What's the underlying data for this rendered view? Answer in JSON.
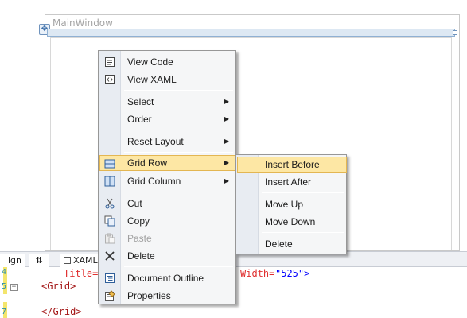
{
  "window": {
    "title": "MainWindow"
  },
  "editor": {
    "tabs": [
      {
        "label": "ign"
      },
      {
        "label": "⇅"
      },
      {
        "label": "XAML"
      }
    ],
    "lines": [
      {
        "num": "4",
        "attr": "Title=",
        "tail_attr": "Width=",
        "tail_val": "\"525\">"
      },
      {
        "num": "5",
        "open_tag": "<Grid>"
      },
      {
        "num": "7",
        "close_tag": "</Grid>"
      }
    ]
  },
  "context_menu": {
    "items": [
      {
        "label": "View Code",
        "icon": "view-code-icon"
      },
      {
        "label": "View XAML",
        "icon": "view-xaml-icon"
      },
      {
        "label": "Select",
        "has_submenu": true
      },
      {
        "label": "Order",
        "has_submenu": true
      },
      {
        "label": "Reset Layout",
        "has_submenu": true
      },
      {
        "label": "Grid Row",
        "icon": "grid-row-icon",
        "has_submenu": true,
        "highlighted": true
      },
      {
        "label": "Grid Column",
        "icon": "grid-column-icon",
        "has_submenu": true
      },
      {
        "label": "Cut",
        "icon": "scissors-icon"
      },
      {
        "label": "Copy",
        "icon": "copy-icon"
      },
      {
        "label": "Paste",
        "icon": "paste-icon",
        "disabled": true
      },
      {
        "label": "Delete",
        "icon": "delete-x-icon"
      },
      {
        "label": "Document Outline",
        "icon": "document-outline-icon"
      },
      {
        "label": "Properties",
        "icon": "properties-icon"
      }
    ]
  },
  "submenu": {
    "items": [
      {
        "label": "Insert Before",
        "highlighted": true
      },
      {
        "label": "Insert After"
      },
      {
        "label": "Move Up"
      },
      {
        "label": "Move Down"
      },
      {
        "label": "Delete"
      }
    ]
  },
  "colors": {
    "highlight_bg": "#fde7a4",
    "highlight_border": "#e3b652",
    "menu_bg": "#f5f6f7",
    "icon_strip": "#e8ecf2"
  }
}
